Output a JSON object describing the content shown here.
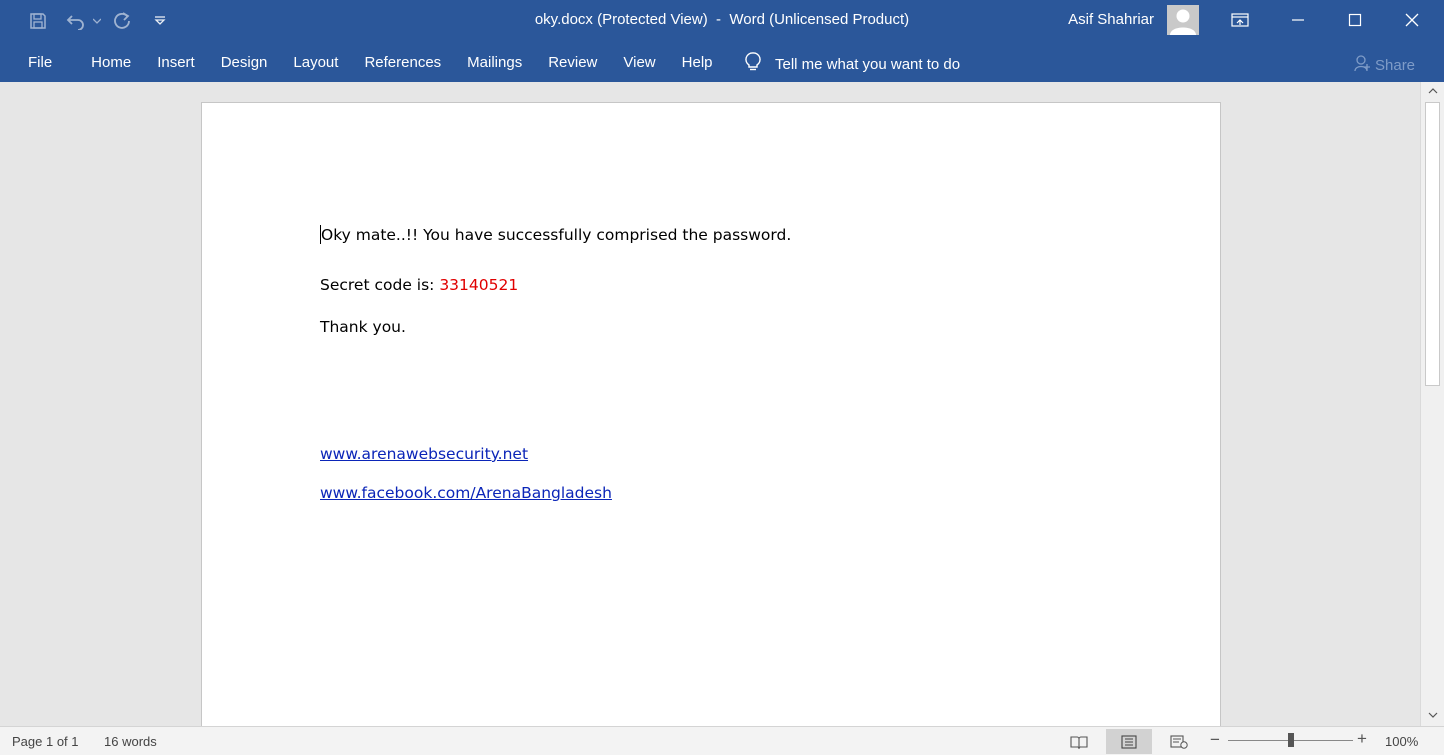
{
  "window": {
    "title": "oky.docx (Protected View)  -  Word (Unlicensed Product)",
    "user_name": "Asif Shahriar"
  },
  "icons": {
    "save": "save-icon",
    "undo": "undo-icon",
    "redo": "redo-icon",
    "customize": "customize-qat-icon",
    "ribbon_display": "ribbon-display-options-icon",
    "minimize": "minimize-icon",
    "maximize": "maximize-icon",
    "close": "close-icon",
    "lightbulb": "lightbulb-icon",
    "share": "person-add-icon"
  },
  "ribbon": {
    "tabs": [
      "File",
      "Home",
      "Insert",
      "Design",
      "Layout",
      "References",
      "Mailings",
      "Review",
      "View",
      "Help"
    ],
    "tell_me": "Tell me what you want to do",
    "share": "Share"
  },
  "document": {
    "line1": "Oky mate..!! You have successfully comprised the password.",
    "secret_label": "Secret code is: ",
    "secret_code": "33140521",
    "line3": "Thank you.",
    "link1": "www.arenawebsecurity.net",
    "link2": "www.facebook.com/ArenaBangladesh"
  },
  "status": {
    "page": "Page 1 of 1",
    "words": "16 words",
    "zoom": "100%"
  },
  "colors": {
    "title_bar": "#2b579a",
    "secret_code": "#e00000",
    "hyperlink": "#0b25b8"
  }
}
